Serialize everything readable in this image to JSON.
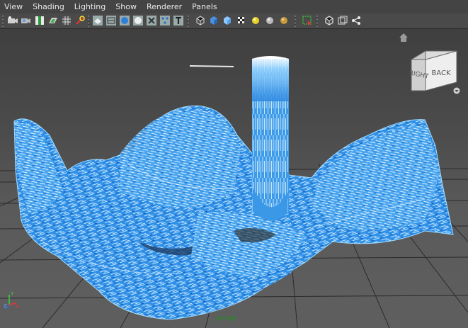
{
  "menubar": {
    "items": [
      {
        "label": "View"
      },
      {
        "label": "Shading"
      },
      {
        "label": "Lighting"
      },
      {
        "label": "Show"
      },
      {
        "label": "Renderer"
      },
      {
        "label": "Panels"
      }
    ]
  },
  "toolbar": {
    "icons": [
      "select-camera-icon",
      "camera-attributes-icon",
      "bookmarks-icon",
      "image-plane-icon",
      "grid-icon",
      "film-gate-icon",
      "resolution-gate-icon",
      "wireframe-icon",
      "smooth-shade-icon",
      "default-material-icon",
      "xray-icon",
      "xray-joints-icon",
      "textured-icon",
      "wireframe-on-shaded-icon",
      "smooth-all-icon",
      "bounding-box-icon",
      "checker-texture-icon",
      "use-all-lights-icon",
      "two-sided-lighting-icon",
      "shadows-icon",
      "isolate-select-icon",
      "component-display-icon",
      "panel-layout-icon",
      "graph-editor-icon"
    ]
  },
  "viewcube": {
    "right_label": "RIGHT",
    "back_label": "BACK"
  },
  "camera_label": "persp",
  "axis": {
    "x_label": "X",
    "y_label": "Y",
    "z_label": "Z"
  },
  "colors": {
    "fluid_light": "#8fd6ff",
    "fluid_mid": "#3a9fea",
    "fluid_dark": "#1566c8",
    "grid_line": "#2a2a2a",
    "menu_text": "#e8e8e8"
  }
}
